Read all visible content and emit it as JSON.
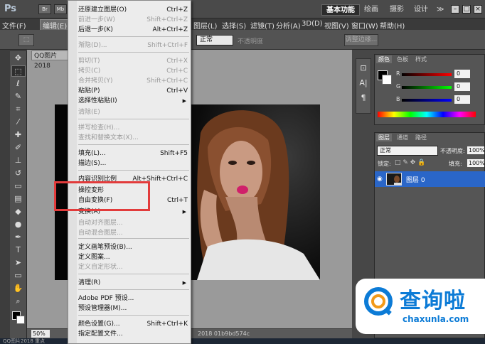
{
  "app": {
    "logo": "Ps"
  },
  "topbar": {
    "mini_buttons": [
      "Br",
      "Mb"
    ],
    "workspaces": [
      "基本功能",
      "绘画",
      "摄影",
      "设计"
    ],
    "more": "≫"
  },
  "menubar": {
    "items": [
      "文件(F)",
      "编辑(E)",
      "图层(L)",
      "选择(S)",
      "滤镜(T)",
      "分析(A)",
      "3D(D)",
      "视图(V)",
      "窗口(W)",
      "帮助(H)"
    ]
  },
  "options": {
    "mode_value": "正常",
    "opacity_label": "不透明度",
    "refine_edge": "调整边缘..."
  },
  "document": {
    "tab_title": "QQ图片2018",
    "zoom": "50%",
    "status_text": "2018 01b9bd574c"
  },
  "taskbar": {
    "left_text": "QQ图片2018   重点"
  },
  "edit_menu": {
    "items": [
      {
        "label": "还原建立图层(O)",
        "shortcut": "Ctrl+Z",
        "disabled": false
      },
      {
        "label": "前进一步(W)",
        "shortcut": "Shift+Ctrl+Z",
        "disabled": true
      },
      {
        "label": "后退一步(K)",
        "shortcut": "Alt+Ctrl+Z",
        "disabled": false
      },
      {
        "label": "渐隐(D)...",
        "shortcut": "Shift+Ctrl+F",
        "disabled": true
      },
      {
        "label": "剪切(T)",
        "shortcut": "Ctrl+X",
        "disabled": true
      },
      {
        "label": "拷贝(C)",
        "shortcut": "Ctrl+C",
        "disabled": true
      },
      {
        "label": "合并拷贝(Y)",
        "shortcut": "Shift+Ctrl+C",
        "disabled": true
      },
      {
        "label": "粘贴(P)",
        "shortcut": "Ctrl+V",
        "disabled": false
      },
      {
        "label": "选择性粘贴(I)",
        "shortcut": "",
        "disabled": false,
        "submenu": true
      },
      {
        "label": "清除(E)",
        "shortcut": "",
        "disabled": true
      },
      {
        "label": "拼写检查(H)...",
        "shortcut": "",
        "disabled": true
      },
      {
        "label": "查找和替换文本(X)...",
        "shortcut": "",
        "disabled": true
      },
      {
        "label": "填充(L)...",
        "shortcut": "Shift+F5",
        "disabled": false
      },
      {
        "label": "描边(S)...",
        "shortcut": "",
        "disabled": false
      },
      {
        "label": "内容识别比例",
        "shortcut": "Alt+Shift+Ctrl+C",
        "disabled": false
      },
      {
        "label": "操控变形",
        "shortcut": "",
        "disabled": false
      },
      {
        "label": "自由变换(F)",
        "shortcut": "Ctrl+T",
        "disabled": false
      },
      {
        "label": "变换(A)",
        "shortcut": "",
        "disabled": false,
        "submenu": true
      },
      {
        "label": "自动对齐图层...",
        "shortcut": "",
        "disabled": true
      },
      {
        "label": "自动混合图层...",
        "shortcut": "",
        "disabled": true
      },
      {
        "label": "定义画笔预设(B)...",
        "shortcut": "",
        "disabled": false
      },
      {
        "label": "定义图案...",
        "shortcut": "",
        "disabled": false
      },
      {
        "label": "定义自定形状...",
        "shortcut": "",
        "disabled": true
      },
      {
        "label": "清理(R)",
        "shortcut": "",
        "disabled": false,
        "submenu": true
      },
      {
        "label": "Adobe PDF 预设...",
        "shortcut": "",
        "disabled": false
      },
      {
        "label": "预设管理器(M)...",
        "shortcut": "",
        "disabled": false
      },
      {
        "label": "颜色设置(G)...",
        "shortcut": "Shift+Ctrl+K",
        "disabled": false
      },
      {
        "label": "指定配置文件...",
        "shortcut": "",
        "disabled": false
      }
    ]
  },
  "color_panel": {
    "tabs": [
      "颜色",
      "色板",
      "样式"
    ],
    "channels": [
      {
        "label": "R",
        "value": "0"
      },
      {
        "label": "G",
        "value": "0"
      },
      {
        "label": "B",
        "value": "0"
      }
    ]
  },
  "layers_panel": {
    "tabs": [
      "图层",
      "通道",
      "路径"
    ],
    "blend_mode": "正常",
    "opacity_label": "不透明度:",
    "opacity_value": "100%",
    "lock_label": "锁定:",
    "fill_label": "填充:",
    "fill_value": "100%",
    "layer_name": "图层 0"
  },
  "watermark": {
    "name": "查询啦",
    "domain": "chaxunla.com"
  }
}
